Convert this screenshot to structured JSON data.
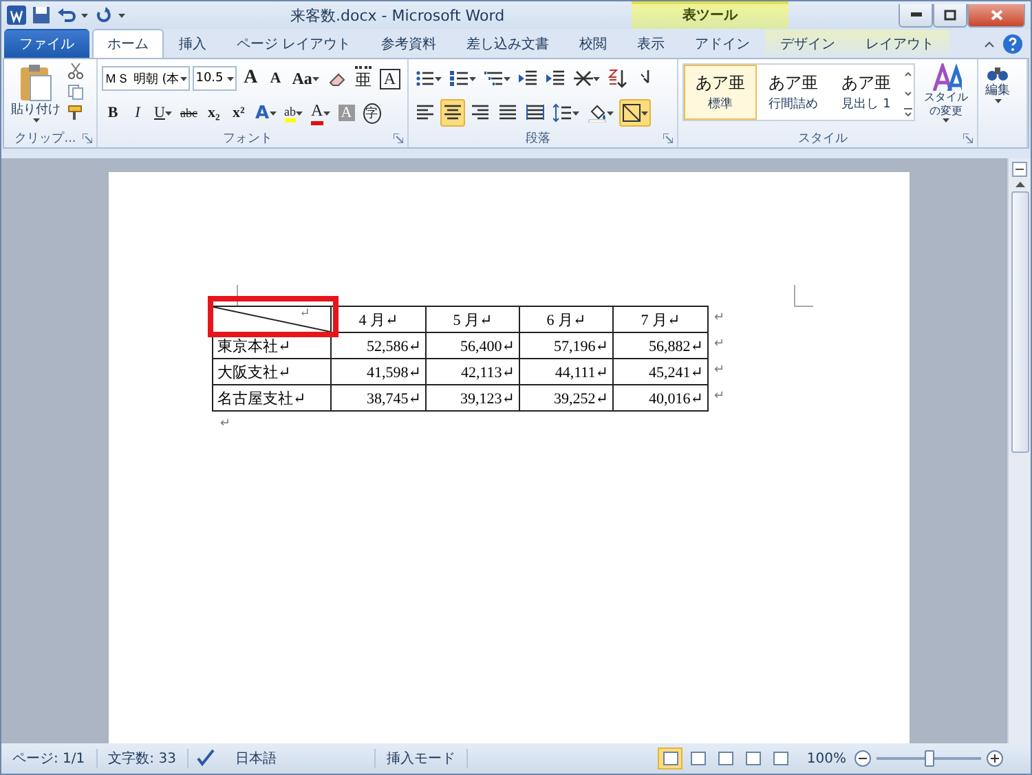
{
  "window": {
    "title": "来客数.docx - Microsoft Word",
    "context_group": "表ツール"
  },
  "tabs": [
    {
      "label": "ファイル",
      "kind": "file",
      "selected": false
    },
    {
      "label": "ホーム",
      "kind": "normal",
      "selected": true
    },
    {
      "label": "挿入",
      "kind": "normal",
      "selected": false
    },
    {
      "label": "ページ レイアウト",
      "kind": "normal",
      "selected": false
    },
    {
      "label": "参考資料",
      "kind": "normal",
      "selected": false
    },
    {
      "label": "差し込み文書",
      "kind": "normal",
      "selected": false
    },
    {
      "label": "校閲",
      "kind": "normal",
      "selected": false
    },
    {
      "label": "表示",
      "kind": "normal",
      "selected": false
    },
    {
      "label": "アドイン",
      "kind": "normal",
      "selected": false
    },
    {
      "label": "デザイン",
      "kind": "context",
      "selected": false
    },
    {
      "label": "レイアウト",
      "kind": "context",
      "selected": false
    }
  ],
  "clipboard": {
    "paste": "貼り付け",
    "label": "クリップ..."
  },
  "font": {
    "name": "ＭＳ 明朝 (本",
    "size": "10.5",
    "label": "フォント",
    "row1": [
      {
        "kind": "grow",
        "text": "A"
      },
      {
        "kind": "shrink",
        "text": "A"
      },
      {
        "kind": "case",
        "text": "Aa"
      },
      {
        "kind": "clear"
      },
      {
        "kind": "ruby",
        "text": "亜"
      },
      {
        "kind": "boxed",
        "text": "A"
      }
    ],
    "row2": [
      {
        "kind": "bold",
        "text": "B"
      },
      {
        "kind": "italic",
        "text": "I"
      },
      {
        "kind": "underline",
        "text": "U"
      },
      {
        "kind": "strike",
        "text": "abc"
      },
      {
        "kind": "sub",
        "text": "x₂"
      },
      {
        "kind": "sup",
        "text": "x²"
      },
      {
        "kind": "effect",
        "text": "A"
      },
      {
        "kind": "highlight",
        "text": "ab"
      },
      {
        "kind": "color",
        "text": "A"
      },
      {
        "kind": "shade",
        "text": "A"
      },
      {
        "kind": "circle",
        "text": "字"
      }
    ]
  },
  "paragraph": {
    "label": "段落",
    "row1": [
      {
        "kind": "bullets",
        "selected": false
      },
      {
        "kind": "numbering",
        "selected": false
      },
      {
        "kind": "multilevel",
        "selected": false
      },
      {
        "kind": "outdent",
        "selected": false
      },
      {
        "kind": "indent",
        "selected": false
      },
      {
        "kind": "asian",
        "selected": false
      },
      {
        "kind": "sort",
        "selected": false
      },
      {
        "kind": "marks",
        "selected": false
      }
    ],
    "row2": [
      {
        "kind": "align-left",
        "selected": false
      },
      {
        "kind": "align-center",
        "selected": true
      },
      {
        "kind": "align-right",
        "selected": false
      },
      {
        "kind": "justify",
        "selected": false
      },
      {
        "kind": "distribute",
        "selected": false
      },
      {
        "kind": "spacing",
        "selected": false
      },
      {
        "kind": "shading",
        "selected": false
      },
      {
        "kind": "borders",
        "selected": true
      }
    ]
  },
  "styles": {
    "label": "スタイル",
    "items": [
      {
        "sample": "あア亜",
        "name": "標準",
        "selected": true
      },
      {
        "sample": "あア亜",
        "name": "行間詰め",
        "selected": false
      },
      {
        "sample": "あア亜",
        "name": "見出し 1",
        "selected": false
      }
    ],
    "change": "スタイルの変更"
  },
  "editing": {
    "label": "編集"
  },
  "table": {
    "highlight_corner": true,
    "header": [
      "↵",
      "4 月↵",
      "5 月↵",
      "6 月↵",
      "7 月↵"
    ],
    "rows": [
      [
        "東京本社↵",
        "52,586↵",
        "56,400↵",
        "57,196↵",
        "56,882↵"
      ],
      [
        "大阪支社↵",
        "41,598↵",
        "42,113↵",
        "44,111↵",
        "45,241↵"
      ],
      [
        "名古屋支社↵",
        "38,745↵",
        "39,123↵",
        "39,252↵",
        "40,016↵"
      ]
    ],
    "row_end_mark": "↵",
    "after_mark": "↵"
  },
  "status_bar": {
    "page": "ページ: 1/1",
    "words": "文字数: 33",
    "language": "日本語",
    "mode": "挿入モード",
    "views": [
      {
        "selected": true
      },
      {
        "selected": false
      },
      {
        "selected": false
      },
      {
        "selected": false
      },
      {
        "selected": false
      }
    ],
    "zoom": "100%",
    "zoom_level": {
      "level": 0.5
    }
  }
}
